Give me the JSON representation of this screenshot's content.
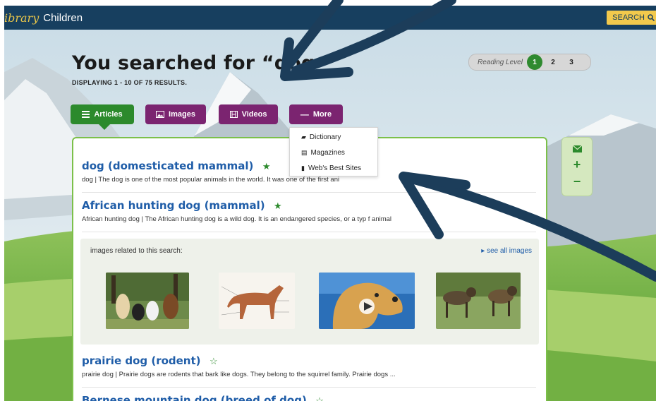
{
  "topbar": {
    "logo": "ibrary",
    "section": "Children",
    "search_label": "SEARCH"
  },
  "heading": "You searched for “dog",
  "result_count": "DISPLAYING 1 - 10 OF 75 RESULTS.",
  "reading_level": {
    "label": "Reading Level",
    "levels": [
      "1",
      "2",
      "3"
    ],
    "active": "1"
  },
  "tabs": [
    {
      "label": "Articles",
      "icon": "list-icon",
      "color": "#2c8a2c"
    },
    {
      "label": "Images",
      "icon": "image-icon",
      "color": "#7b2470"
    },
    {
      "label": "Videos",
      "icon": "film-icon",
      "color": "#7b2470"
    },
    {
      "label": "More",
      "icon": "minus-icon",
      "color": "#7b2470"
    }
  ],
  "more_menu": [
    {
      "label": "Dictionary",
      "icon": "book-icon"
    },
    {
      "label": "Magazines",
      "icon": "document-icon"
    },
    {
      "label": "Web's Best Sites",
      "icon": "bookmark-icon"
    }
  ],
  "results": [
    {
      "title": "dog (domesticated mammal)",
      "snippet": "dog   |   The dog is one of the most popular animals in the world. It was one of the first ani",
      "starred": true
    },
    {
      "title": "African hunting dog (mammal)",
      "snippet": "African hunting dog   |   The African hunting dog is a wild dog. It is an endangered species, or a typ   f animal",
      "starred": true
    },
    {
      "title": "prairie dog (rodent)",
      "snippet": "prairie dog   |   Prairie dogs are rodents that bark like dogs. They belong to the squirrel family. Prairie dogs ...",
      "starred": false
    },
    {
      "title": "Bernese mountain dog (breed of dog)",
      "snippet": "",
      "starred": false
    }
  ],
  "images_panel": {
    "label": "images related to this search:",
    "see_all": "▸ see all images",
    "thumbnails": [
      "dogs-group-photo",
      "dog-anatomy-diagram",
      "golden-retriever-video",
      "african-wild-dogs-photo"
    ]
  },
  "side_tools": [
    "mail-icon",
    "zoom-in-icon",
    "zoom-out-icon"
  ],
  "colors": {
    "topbar": "#173f5f",
    "green": "#2c8a2c",
    "purple": "#7b2470",
    "link": "#1f5da8",
    "arrow": "#1c3d5a"
  }
}
